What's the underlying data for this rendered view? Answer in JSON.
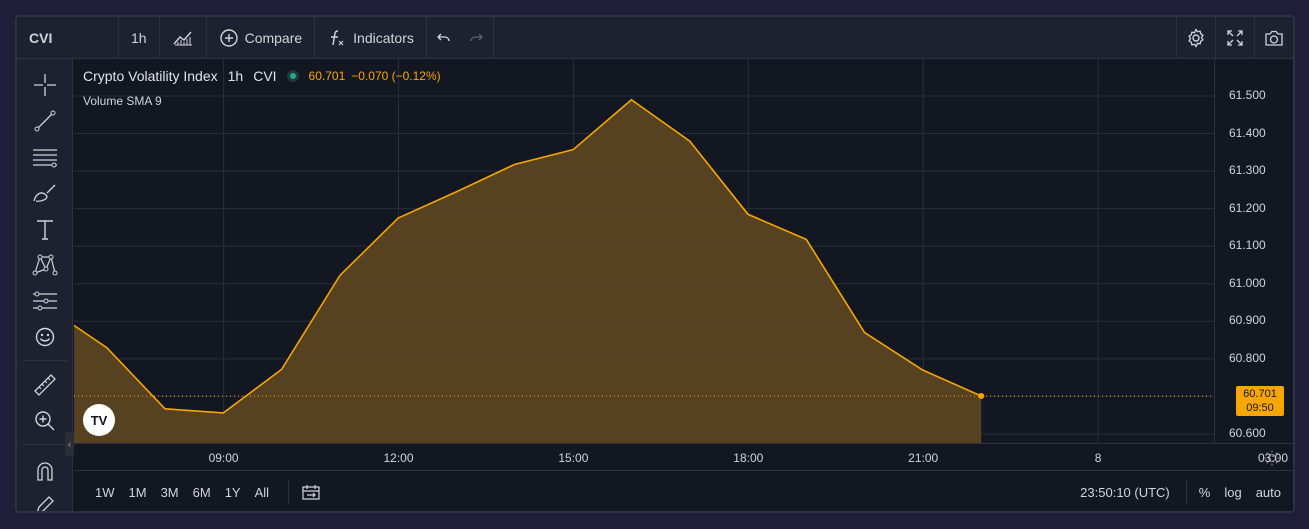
{
  "toolbar": {
    "symbol": "CVI",
    "interval": "1h",
    "compare_label": "Compare",
    "indicators_label": "Indicators"
  },
  "legend": {
    "title": "Crypto Volatility Index",
    "interval": "1h",
    "source": "CVI",
    "value": "60.701",
    "change": "−0.070 (−0.12%)",
    "indicator": "Volume SMA 9"
  },
  "price_axis": [
    "61.500",
    "61.400",
    "61.300",
    "61.200",
    "61.100",
    "61.000",
    "60.900",
    "60.800",
    "60.600"
  ],
  "time_axis": [
    "09:00",
    "12:00",
    "15:00",
    "18:00",
    "21:00",
    "8",
    "03:00"
  ],
  "last_price": {
    "value": "60.701",
    "countdown": "09:50"
  },
  "bottom": {
    "ranges": [
      "1W",
      "1M",
      "3M",
      "6M",
      "1Y",
      "All"
    ],
    "clock": "23:50:10 (UTC)",
    "percent": "%",
    "log": "log",
    "auto": "auto"
  },
  "colors": {
    "line": "#f7a600",
    "area": "#5a4322",
    "background": "#131722",
    "grid": "#2a2e39"
  },
  "chart_data": {
    "type": "area",
    "x": [
      "07:00",
      "08:00",
      "09:00",
      "10:00",
      "11:00",
      "12:00",
      "13:00",
      "14:00",
      "15:00",
      "16:00",
      "17:00",
      "18:00",
      "19:00",
      "20:00",
      "21:00",
      "22:00",
      "23:00"
    ],
    "values": [
      60.935,
      60.83,
      60.667,
      60.656,
      60.772,
      61.022,
      61.175,
      61.245,
      61.318,
      61.357,
      61.49,
      61.38,
      61.185,
      61.118,
      60.87,
      60.77,
      60.701
    ],
    "ylim": [
      60.56,
      61.53
    ],
    "x_ticks": [
      "09:00",
      "12:00",
      "15:00",
      "18:00",
      "21:00",
      "8",
      "03:00"
    ],
    "y_ticks": [
      "61.500",
      "61.400",
      "61.300",
      "61.200",
      "61.100",
      "61.000",
      "60.900",
      "60.800",
      "60.600"
    ]
  }
}
